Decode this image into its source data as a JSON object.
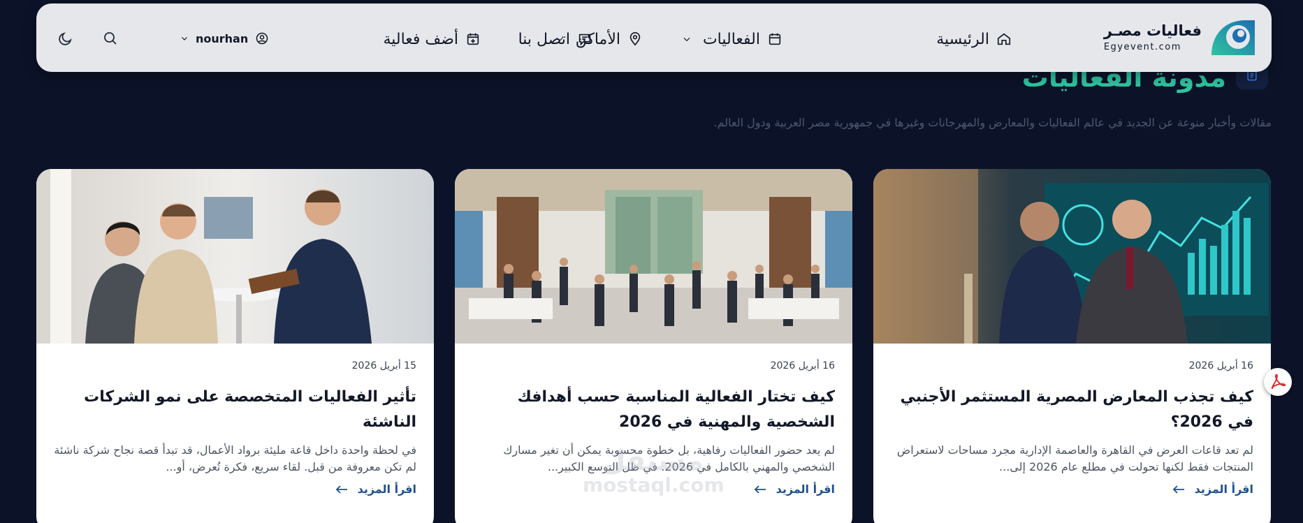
{
  "brand": {
    "name": "فعاليات مصـر",
    "url": "Egyevent.com"
  },
  "nav": {
    "home": "الرئيسية",
    "events": "الفعاليات",
    "places": "الأماكن",
    "contact": "اتصل بنا",
    "add_event": "أضف فعالية",
    "username": "nourhan",
    "icons": [
      "home-icon",
      "calendar-icon",
      "map-pin-icon",
      "message-icon",
      "calendar-plus-icon",
      "user-icon",
      "search-icon",
      "moon-icon"
    ]
  },
  "header": {
    "title": "مدونة الفعاليات",
    "subtitle": "مقالات وأخبار منوعة عن الجديد في عالم الفعاليات والمعارض والمهرجانات وغيرها في جمهورية مصر العربية ودول العالم."
  },
  "cards": [
    {
      "date": "16 أبريل 2026",
      "title": "كيف تجذب المعارض المصرية المستثمر الأجنبي في 2026؟",
      "excerpt": "لم تعد قاعات العرض في القاهرة والعاصمة الإدارية مجرد مساحات لاستعراض المنتجات فقط لكنها تحولت في مطلع عام 2026 إلى...",
      "read_more": "اقرأ المزيد"
    },
    {
      "date": "16 أبريل 2026",
      "title": "كيف تختار الفعالية المناسبة حسب أهدافك الشخصية والمهنية في 2026",
      "excerpt": "لم يعد حضور الفعاليات رفاهية، بل خطوة محسوبة يمكن أن تغير مسارك الشخصي والمهني بالكامل في 2026. في ظل التوسع الكبير...",
      "read_more": "اقرأ المزيد"
    },
    {
      "date": "15 أبريل 2026",
      "title": "تأثير الفعاليات المتخصصة على نمو الشركات الناشئة",
      "excerpt": "في لحظة واحدة داخل قاعة مليئة برواد الأعمال، قد تبدأ قصة نجاح شركة ناشئة لم تكن معروفة من قبل. لقاء سريع، فكرة تُعرض، أو...",
      "read_more": "اقرأ المزيد"
    }
  ],
  "watermark": {
    "arabic": "مستقل",
    "latin": "mostaql.com"
  },
  "colors": {
    "page_bg": "#0c1329",
    "accent": "#2ec4a0",
    "link": "#1e4f8f",
    "navbar_bg": "#e5e7eb"
  }
}
